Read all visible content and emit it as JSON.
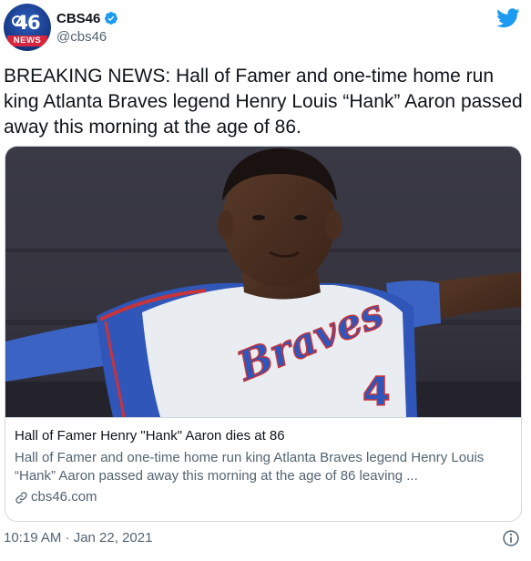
{
  "author": {
    "display_name": "CBS46",
    "handle": "@cbs46",
    "verified": true,
    "avatar": {
      "number": "46",
      "label": "NEWS",
      "brand_color": "#1b3f8f",
      "label_color": "#d7263d"
    }
  },
  "brand_icon": "twitter-bird-icon",
  "tweet": {
    "text": "BREAKING NEWS: Hall of Famer and one-time home run king Atlanta Braves legend Henry Louis “Hank” Aaron passed away this morning at the age of 86."
  },
  "card": {
    "image_jersey_text": "Braves",
    "image_jersey_number": "4",
    "title": "Hall of Famer Henry \"Hank\" Aaron dies at 86",
    "description": "Hall of Famer and one-time home run king Atlanta Braves legend Henry Louis “Hank” Aaron passed away this morning at the age of 86 leaving ...",
    "domain": "cbs46.com",
    "domain_icon": "link-icon"
  },
  "meta": {
    "timestamp": "10:19 AM · Jan 22, 2021",
    "info_icon": "info-icon"
  },
  "colors": {
    "text_primary": "#0f1419",
    "text_secondary": "#536471",
    "twitter_blue": "#1d9bf0",
    "border": "#cfd9de"
  }
}
